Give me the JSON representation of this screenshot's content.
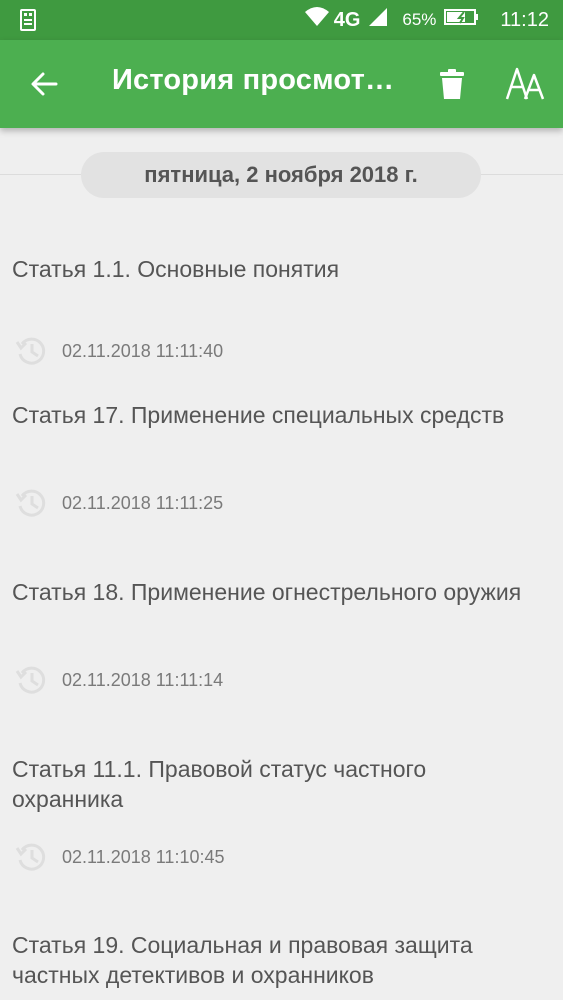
{
  "status_bar": {
    "network": "4G",
    "battery": "65%",
    "time": "11:12",
    "icons": [
      "usb-icon",
      "wifi-icon",
      "signal-icon",
      "battery-icon"
    ]
  },
  "app_bar": {
    "title": "История просмотров",
    "back_icon": "back-arrow-icon",
    "delete_icon": "trash-icon",
    "font_icon": "font-size-icon"
  },
  "date_header": "пятница, 2 ноября 2018 г.",
  "history": [
    {
      "title": "Статья 1.1. Основные понятия",
      "time": "02.11.2018 11:11:40"
    },
    {
      "title": "Статья 17. Применение специальных средств",
      "time": "02.11.2018 11:11:25"
    },
    {
      "title": "Статья 18. Применение огнестрельного оружия",
      "time": "02.11.2018 11:11:14"
    },
    {
      "title": "Статья 11.1. Правовой статус частного охранника",
      "time": "02.11.2018 11:10:45"
    },
    {
      "title": "Статья 19. Социальная и правовая защита частных детективов и охранников",
      "time": ""
    }
  ],
  "colors": {
    "status_bar": "#3f9a40",
    "app_bar": "#4caf50",
    "background": "#efefef"
  }
}
